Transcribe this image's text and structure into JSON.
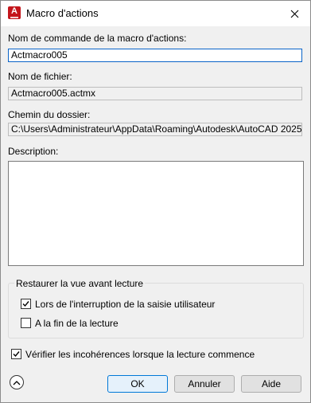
{
  "window": {
    "title": "Macro d'actions"
  },
  "form": {
    "command_name_label": "Nom de commande de la macro d'actions:",
    "command_name_value": "Actmacro005",
    "file_name_label": "Nom de fichier:",
    "file_name_value": "Actmacro005.actmx",
    "folder_path_label": "Chemin du dossier:",
    "folder_path_value": "C:\\Users\\Administrateur\\AppData\\Roaming\\Autodesk\\AutoCAD 2025\\",
    "description_label": "Description:",
    "description_value": ""
  },
  "restore_view": {
    "legend": "Restaurer la vue avant lecture",
    "option1_label": "Lors de l'interruption de la saisie utilisateur",
    "option1_checked": true,
    "option2_label": "A la fin de la lecture",
    "option2_checked": false
  },
  "check_inconsistencies": {
    "label": "Vérifier les incohérences lorsque la lecture commence",
    "checked": true
  },
  "buttons": {
    "ok": "OK",
    "cancel": "Annuler",
    "help": "Aide"
  },
  "icons": {
    "app": "autocad-app-icon",
    "close": "close-icon",
    "collapse": "chevron-up-icon"
  },
  "colors": {
    "accent": "#0078d7",
    "app_icon": "#c4161c"
  }
}
